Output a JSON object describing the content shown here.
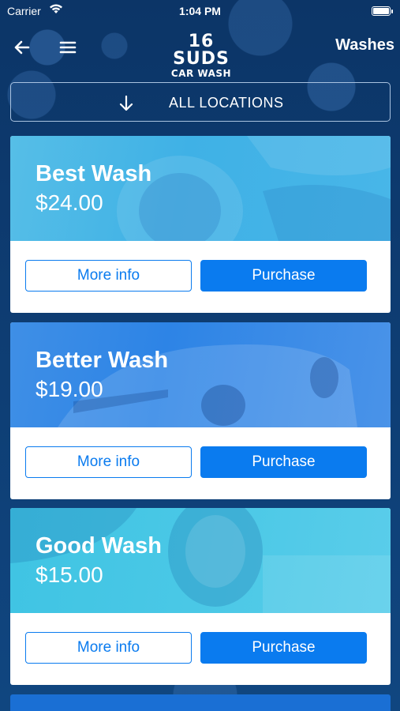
{
  "status_bar": {
    "carrier": "Carrier",
    "time": "1:04 PM"
  },
  "nav": {
    "logo_line1": "16 SUDS",
    "logo_line2": "CAR WASH",
    "title": "Washes"
  },
  "location_selector": {
    "label": "ALL LOCATIONS"
  },
  "washes": [
    {
      "name": "Best Wash",
      "price": "$24.00",
      "more_label": "More info",
      "buy_label": "Purchase"
    },
    {
      "name": "Better Wash",
      "price": "$19.00",
      "more_label": "More info",
      "buy_label": "Purchase"
    },
    {
      "name": "Good Wash",
      "price": "$15.00",
      "more_label": "More info",
      "buy_label": "Purchase"
    }
  ],
  "colors": {
    "background": "#0d3a6e",
    "accent": "#0a7bef",
    "card_banner_1": "#48b6e8",
    "card_banner_2": "#2d84e6",
    "card_banner_3": "#4ac8e6"
  },
  "icons": {
    "back": "arrow-left-icon",
    "menu": "hamburger-menu-icon",
    "location_arrow": "arrow-down-icon",
    "wifi": "wifi-icon",
    "battery": "battery-icon"
  }
}
